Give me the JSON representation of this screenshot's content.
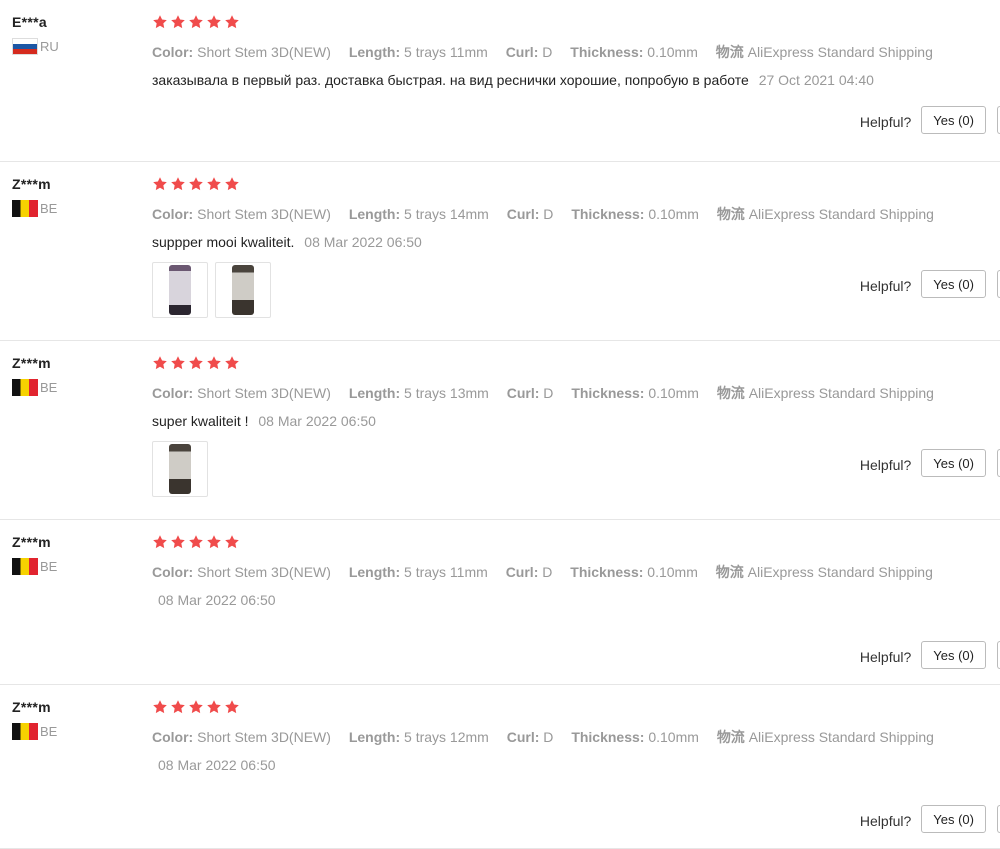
{
  "colors": {
    "star": "#f04b4b",
    "muted": "#999999",
    "text": "#222222"
  },
  "reviews": [
    {
      "user": "E***a",
      "country_code": "RU",
      "flag": "flag-russia",
      "rating": 5,
      "color_key": "Color:",
      "color_val": "Short Stem 3D(NEW)",
      "length_key": "Length:",
      "length_val": "5 trays 11mm",
      "curl_key": "Curl:",
      "curl_val": "D",
      "thick_key": "Thickness:",
      "thick_val": "0.10mm",
      "ship_key": "物流",
      "ship_val": "AliExpress Standard Shipping",
      "text": "заказывала в первый раз. доставка быстрая. на вид реснички хорошие, попробую в работе",
      "date": "27 Oct 2021 04:40",
      "helpful": "Helpful?",
      "yes": "Yes (0)"
    },
    {
      "user": "Z***m",
      "country_code": "BE",
      "flag": "flag-belgium",
      "rating": 5,
      "color_key": "Color:",
      "color_val": "Short Stem 3D(NEW)",
      "length_key": "Length:",
      "length_val": "5 trays 14mm",
      "curl_key": "Curl:",
      "curl_val": "D",
      "thick_key": "Thickness:",
      "thick_val": "0.10mm",
      "ship_key": "物流",
      "ship_val": "AliExpress Standard Shipping",
      "text": "suppper mooi kwaliteit.",
      "date": "08 Mar 2022 06:50",
      "helpful": "Helpful?",
      "yes": "Yes (0)"
    },
    {
      "user": "Z***m",
      "country_code": "BE",
      "flag": "flag-belgium",
      "rating": 5,
      "color_key": "Color:",
      "color_val": "Short Stem 3D(NEW)",
      "length_key": "Length:",
      "length_val": "5 trays 13mm",
      "curl_key": "Curl:",
      "curl_val": "D",
      "thick_key": "Thickness:",
      "thick_val": "0.10mm",
      "ship_key": "物流",
      "ship_val": "AliExpress Standard Shipping",
      "text": "super kwaliteit !",
      "date": "08 Mar 2022 06:50",
      "helpful": "Helpful?",
      "yes": "Yes (0)"
    },
    {
      "user": "Z***m",
      "country_code": "BE",
      "flag": "flag-belgium",
      "rating": 5,
      "color_key": "Color:",
      "color_val": "Short Stem 3D(NEW)",
      "length_key": "Length:",
      "length_val": "5 trays 11mm",
      "curl_key": "Curl:",
      "curl_val": "D",
      "thick_key": "Thickness:",
      "thick_val": "0.10mm",
      "ship_key": "物流",
      "ship_val": "AliExpress Standard Shipping",
      "text": "",
      "date": "08 Mar 2022 06:50",
      "helpful": "Helpful?",
      "yes": "Yes (0)"
    },
    {
      "user": "Z***m",
      "country_code": "BE",
      "flag": "flag-belgium",
      "rating": 5,
      "color_key": "Color:",
      "color_val": "Short Stem 3D(NEW)",
      "length_key": "Length:",
      "length_val": "5 trays 12mm",
      "curl_key": "Curl:",
      "curl_val": "D",
      "thick_key": "Thickness:",
      "thick_val": "0.10mm",
      "ship_key": "物流",
      "ship_val": "AliExpress Standard Shipping",
      "text": "",
      "date": "08 Mar 2022 06:50",
      "helpful": "Helpful?",
      "yes": "Yes (0)"
    }
  ]
}
